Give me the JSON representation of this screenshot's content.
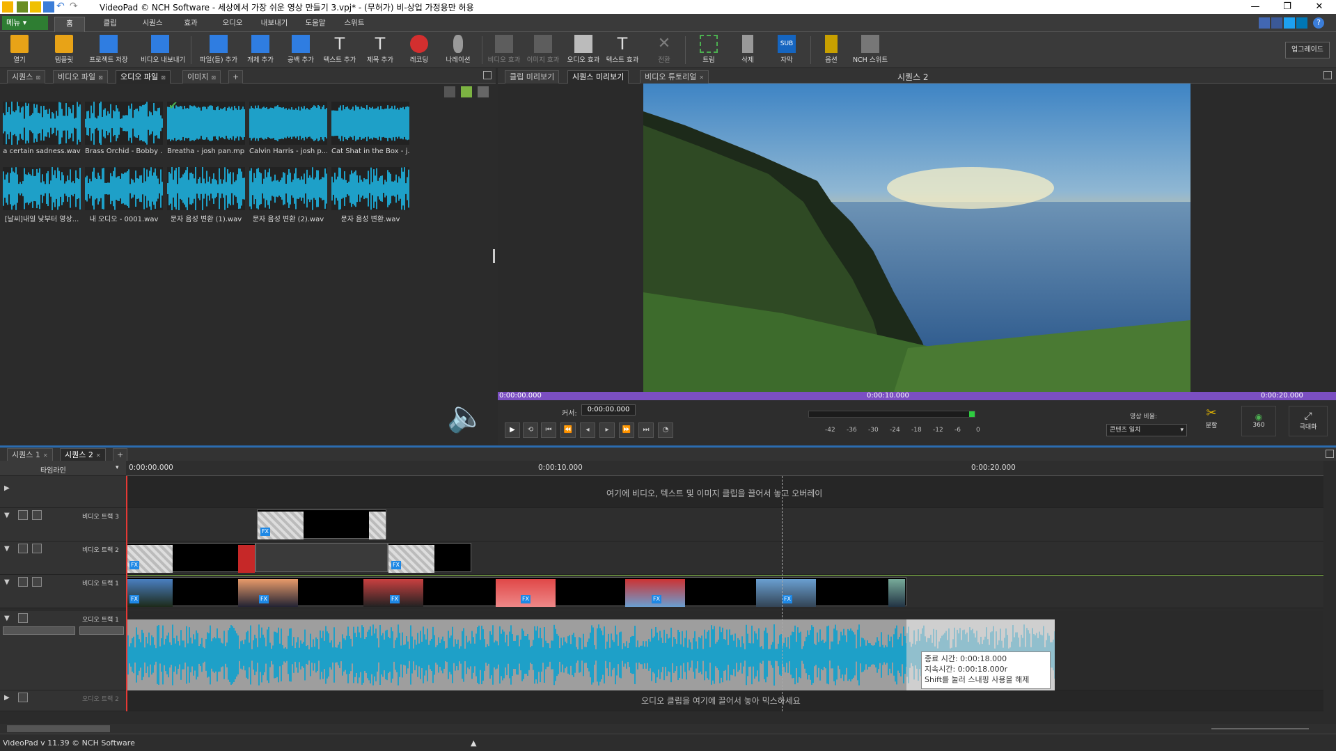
{
  "window": {
    "title": "VideoPad © NCH Software - 세상에서 가장 쉬운 영상 만들기 3.vpj* - (무허가) 비-상업 가정용만 허용",
    "minimize": "—",
    "restore": "❐",
    "close": "✕"
  },
  "menu": {
    "menu_button": "메뉴 ▾",
    "tabs": [
      "홈",
      "클립",
      "시퀀스",
      "효과",
      "오디오",
      "내보내기",
      "도움말",
      "스위트"
    ]
  },
  "toolbar": {
    "buttons": [
      {
        "label": "열기",
        "icon": "open-folder-icon"
      },
      {
        "label": "템플릿",
        "icon": "template-icon"
      },
      {
        "label": "프로젝트 저장",
        "icon": "save-icon"
      },
      {
        "label": "비디오 내보내기",
        "icon": "export-video-icon"
      },
      {
        "label": "파일(들) 추가",
        "icon": "add-file-icon"
      },
      {
        "label": "개체 추가",
        "icon": "add-object-icon"
      },
      {
        "label": "공백 추가",
        "icon": "add-blank-icon"
      },
      {
        "label": "텍스트 추가",
        "icon": "add-text-icon"
      },
      {
        "label": "제목 추가",
        "icon": "add-title-icon"
      },
      {
        "label": "레코딩",
        "icon": "record-icon"
      },
      {
        "label": "나레이션",
        "icon": "microphone-icon"
      },
      {
        "label": "비디오 효과",
        "icon": "video-fx-icon",
        "disabled": true
      },
      {
        "label": "이미지 효과",
        "icon": "image-fx-icon",
        "disabled": true
      },
      {
        "label": "오디오 효과",
        "icon": "audio-fx-icon"
      },
      {
        "label": "텍스트 효과",
        "icon": "text-fx-icon"
      },
      {
        "label": "전환",
        "icon": "transition-icon",
        "disabled": true
      },
      {
        "label": "트림",
        "icon": "trim-icon"
      },
      {
        "label": "삭제",
        "icon": "delete-icon"
      },
      {
        "label": "자막",
        "icon": "subtitle-icon"
      },
      {
        "label": "옵션",
        "icon": "options-icon"
      },
      {
        "label": "NCH 스위트",
        "icon": "nch-suite-icon"
      }
    ],
    "upgrade": "업그레이드"
  },
  "bin": {
    "tabs": [
      "시퀀스",
      "비디오 파일",
      "오디오 파일",
      "이미지"
    ],
    "add_tab": "+",
    "clips": [
      "a certain sadness.wav",
      "Brass Orchid - Bobby ...",
      "Breatha - josh pan.mp3",
      "Calvin Harris - josh p...",
      "Cat Shat in the Box - j...",
      "[날씨]내일 낮부터 영상...",
      "내 오디오 - 0001.wav",
      "문자 음성 변환 (1).wav",
      "문자 음성 변환 (2).wav",
      "문자 음성 변환.wav"
    ]
  },
  "preview": {
    "tabs": [
      "클립 미리보기",
      "시퀀스 미리보기",
      "비디오 튜토리얼"
    ],
    "title": "시퀀스 2",
    "scrub_times": [
      "0:00:00.000",
      "0:00:10.000",
      "0:00:20.000"
    ],
    "cursor_label": "커서:",
    "cursor_value": "0:00:00.000",
    "meter_scale": [
      "-42",
      "-36",
      "-30",
      "-24",
      "-18",
      "-12",
      "-6",
      "0"
    ],
    "ratio_label": "영상 비율:",
    "ratio_value": "콘텐츠 일치",
    "split_label": "분할",
    "vr_label": "360",
    "fullscreen_label": "극대화"
  },
  "timeline": {
    "seq_tabs": [
      "시퀀스 1",
      "시퀀스 2"
    ],
    "add_tab": "+",
    "mode": "타임라인",
    "ruler": [
      "0:00:00.000",
      "0:00:10.000",
      "0:00:20.000"
    ],
    "overlay_hint": "여기에 비디오, 텍스트 및 이미지 클립을 끌어서 놓고 오버레이",
    "tracks": [
      "비디오 트랙 3",
      "비디오 트랙 2",
      "비디오 트랙 1",
      "오디오 트랙 1",
      "오디오 트랙 2"
    ],
    "audio_hint": "오디오 클립을 여기에 끌어서 놓아 믹스하세요",
    "tooltip": [
      "종료 시간: 0:00:18.000",
      "지속시간: 0:00:18.000r",
      "Shift를 눌러 스내핑 사용을 해제"
    ],
    "fx": "FX"
  },
  "status": {
    "text": "VideoPad v 11.39 © NCH Software"
  },
  "colors": {
    "accent_green": "#2e7d32",
    "wave_blue": "#1ea0c8",
    "scrub_purple": "#7b4fc2",
    "sequence_blue": "#2b6cb0"
  }
}
